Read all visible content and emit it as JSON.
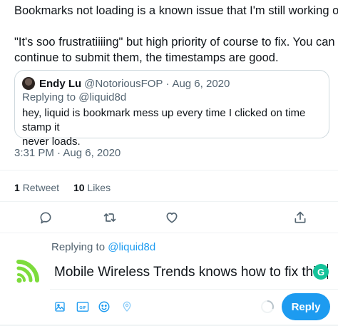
{
  "tweet": {
    "line1": "Bookmarks not loading is a known issue that I'm still working on.",
    "line2": "\"It's soo frustratiiiing\" but high priority of course to fix. You can",
    "line3": "continue to submit them, the timestamps are good."
  },
  "quote": {
    "name": "Endy Lu",
    "handle": "@NotoriousFOP",
    "separator": "·",
    "date": "Aug 6, 2020",
    "replying_prefix": "Replying to ",
    "replying_mention": "@liquid8d",
    "body_line1": "hey, liquid is bookmark mess up every time I clicked on time stamp it",
    "body_line2": "never loads."
  },
  "timestamp": "3:31 PM · Aug 6, 2020",
  "stats": {
    "retweets_count": "1",
    "retweets_label": "Retweet",
    "likes_count": "10",
    "likes_label": "Likes"
  },
  "actions": {
    "icons": [
      "reply-icon",
      "retweet-icon",
      "like-icon",
      "share-icon"
    ],
    "icon_color": "#536471"
  },
  "composer": {
    "replying_prefix": "Replying to ",
    "replying_mention": "@liquid8d",
    "text": "Mobile Wireless Trends knows how to fix this!",
    "grammarly_badge": "G",
    "reply_button": "Reply",
    "tool_icons": [
      "image-icon",
      "gif-icon",
      "emoji-icon",
      "location-icon"
    ]
  },
  "colors": {
    "accent": "#1d9bf0",
    "secondary_text": "#536471",
    "border": "#cfd9de",
    "avatar_green": "#7ddc3c",
    "grammarly": "#15c39a"
  }
}
